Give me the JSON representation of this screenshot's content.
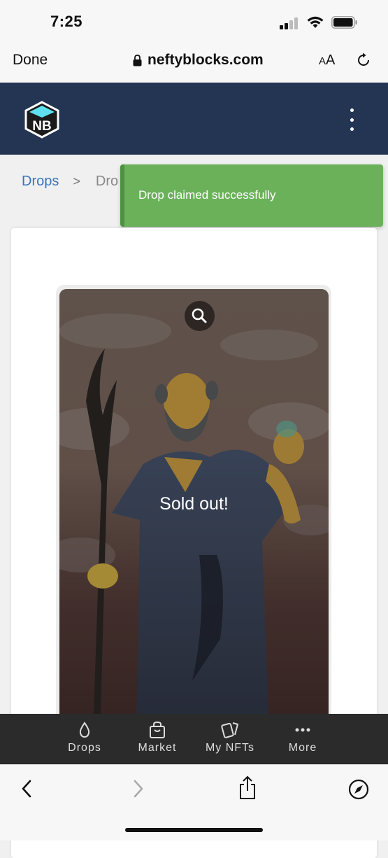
{
  "status_bar": {
    "time": "7:25",
    "icons": [
      "cellular-signal-icon",
      "wifi-icon",
      "battery-icon"
    ]
  },
  "browser": {
    "done_label": "Done",
    "url": "neftyblocks.com",
    "text_size_label_small": "A",
    "text_size_label_large": "A"
  },
  "site_header": {
    "logo_text": "NB",
    "menu_icon": "kebab-menu-icon",
    "bg_color": "#233553"
  },
  "breadcrumb": {
    "root": "Drops",
    "separator": ">",
    "current": "Dro"
  },
  "toast": {
    "message": "Drop claimed successfully",
    "color": "#6ab15a"
  },
  "drop_card": {
    "overlay_text": "Sold out!",
    "zoom_icon": "magnifier-icon"
  },
  "bottom_nav": {
    "items": [
      {
        "label": "Drops",
        "icon": "drop-icon"
      },
      {
        "label": "Market",
        "icon": "shopping-bag-icon"
      },
      {
        "label": "My NFTs",
        "icon": "cards-icon"
      },
      {
        "label": "More",
        "icon": "ellipsis-icon"
      }
    ]
  },
  "browser_toolbar": {
    "icons": [
      "back-icon",
      "forward-icon",
      "share-icon",
      "compass-icon"
    ]
  }
}
